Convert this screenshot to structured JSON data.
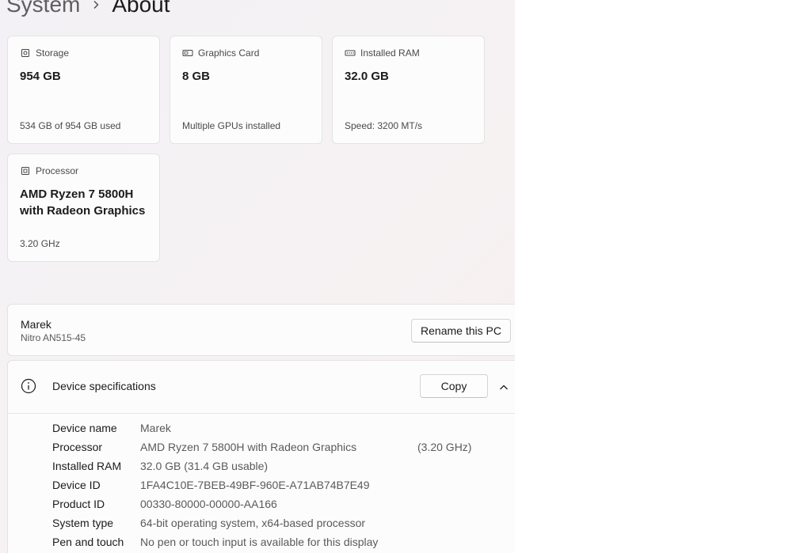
{
  "breadcrumb": {
    "parent": "System",
    "current": "About"
  },
  "cards": [
    {
      "icon": "storage-icon",
      "label": "Storage",
      "value": "954 GB",
      "sub": "534 GB of 954 GB used"
    },
    {
      "icon": "graphics-card-icon",
      "label": "Graphics Card",
      "value": "8 GB",
      "sub": "Multiple GPUs installed"
    },
    {
      "icon": "ram-icon",
      "label": "Installed RAM",
      "value": "32.0 GB",
      "sub": "Speed: 3200 MT/s"
    },
    {
      "icon": "processor-icon",
      "label": "Processor",
      "value_line1": "AMD Ryzen 7 5800H",
      "value_line2": "with Radeon Graphics",
      "sub": "3.20 GHz"
    }
  ],
  "pc": {
    "name": "Marek",
    "model": "Nitro AN515-45",
    "rename_label": "Rename this PC"
  },
  "specs": {
    "title": "Device specifications",
    "copy_label": "Copy",
    "rows": [
      {
        "label": "Device name",
        "value": "Marek"
      },
      {
        "label": "Processor",
        "value": "AMD Ryzen 7 5800H with Radeon Graphics",
        "extra": "(3.20 GHz)"
      },
      {
        "label": "Installed RAM",
        "value": "32.0 GB (31.4 GB usable)"
      },
      {
        "label": "Device ID",
        "value": "1FA4C10E-7BEB-49BF-960E-A71AB74B7E49"
      },
      {
        "label": "Product ID",
        "value": "00330-80000-00000-AA166"
      },
      {
        "label": "System type",
        "value": "64-bit operating system, x64-based processor"
      },
      {
        "label": "Pen and touch",
        "value": "No pen or touch input is available for this display"
      }
    ]
  }
}
